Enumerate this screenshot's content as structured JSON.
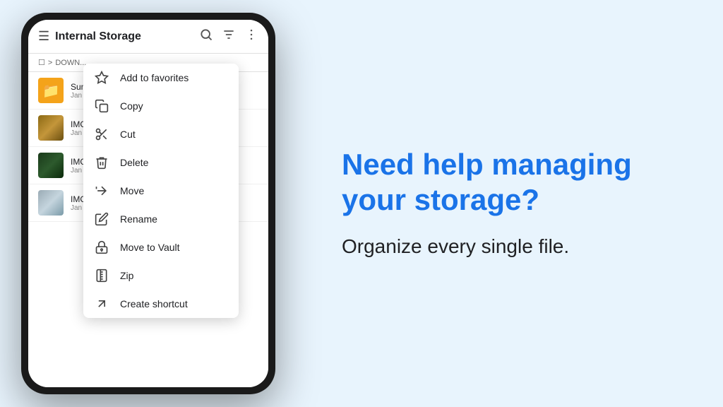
{
  "phone": {
    "topBar": {
      "title": "Internal Storage",
      "icons": [
        "search",
        "filter",
        "more"
      ]
    },
    "breadcrumb": {
      "items": [
        "☐",
        ">",
        "DOWN..."
      ]
    },
    "files": [
      {
        "type": "folder",
        "name": "Sum...",
        "date": "Jan 1"
      },
      {
        "type": "img1",
        "name": "IMG_",
        "date": "Jan 1"
      },
      {
        "type": "img2",
        "name": "IMG_",
        "date": "Jan 1"
      },
      {
        "type": "img3",
        "name": "IMG_",
        "date": "Jan 1"
      }
    ],
    "contextMenu": {
      "items": [
        {
          "id": "add-favorites",
          "label": "Add to favorites",
          "icon": "star"
        },
        {
          "id": "copy",
          "label": "Copy",
          "icon": "copy"
        },
        {
          "id": "cut",
          "label": "Cut",
          "icon": "scissors"
        },
        {
          "id": "delete",
          "label": "Delete",
          "icon": "trash"
        },
        {
          "id": "move",
          "label": "Move",
          "icon": "move"
        },
        {
          "id": "rename",
          "label": "Rename",
          "icon": "edit"
        },
        {
          "id": "vault",
          "label": "Move to Vault",
          "icon": "lock"
        },
        {
          "id": "zip",
          "label": "Zip",
          "icon": "zip"
        },
        {
          "id": "shortcut",
          "label": "Create shortcut",
          "icon": "shortcut"
        }
      ]
    }
  },
  "promo": {
    "headline": "Need help managing your storage?",
    "subtext": "Organize every single file."
  }
}
